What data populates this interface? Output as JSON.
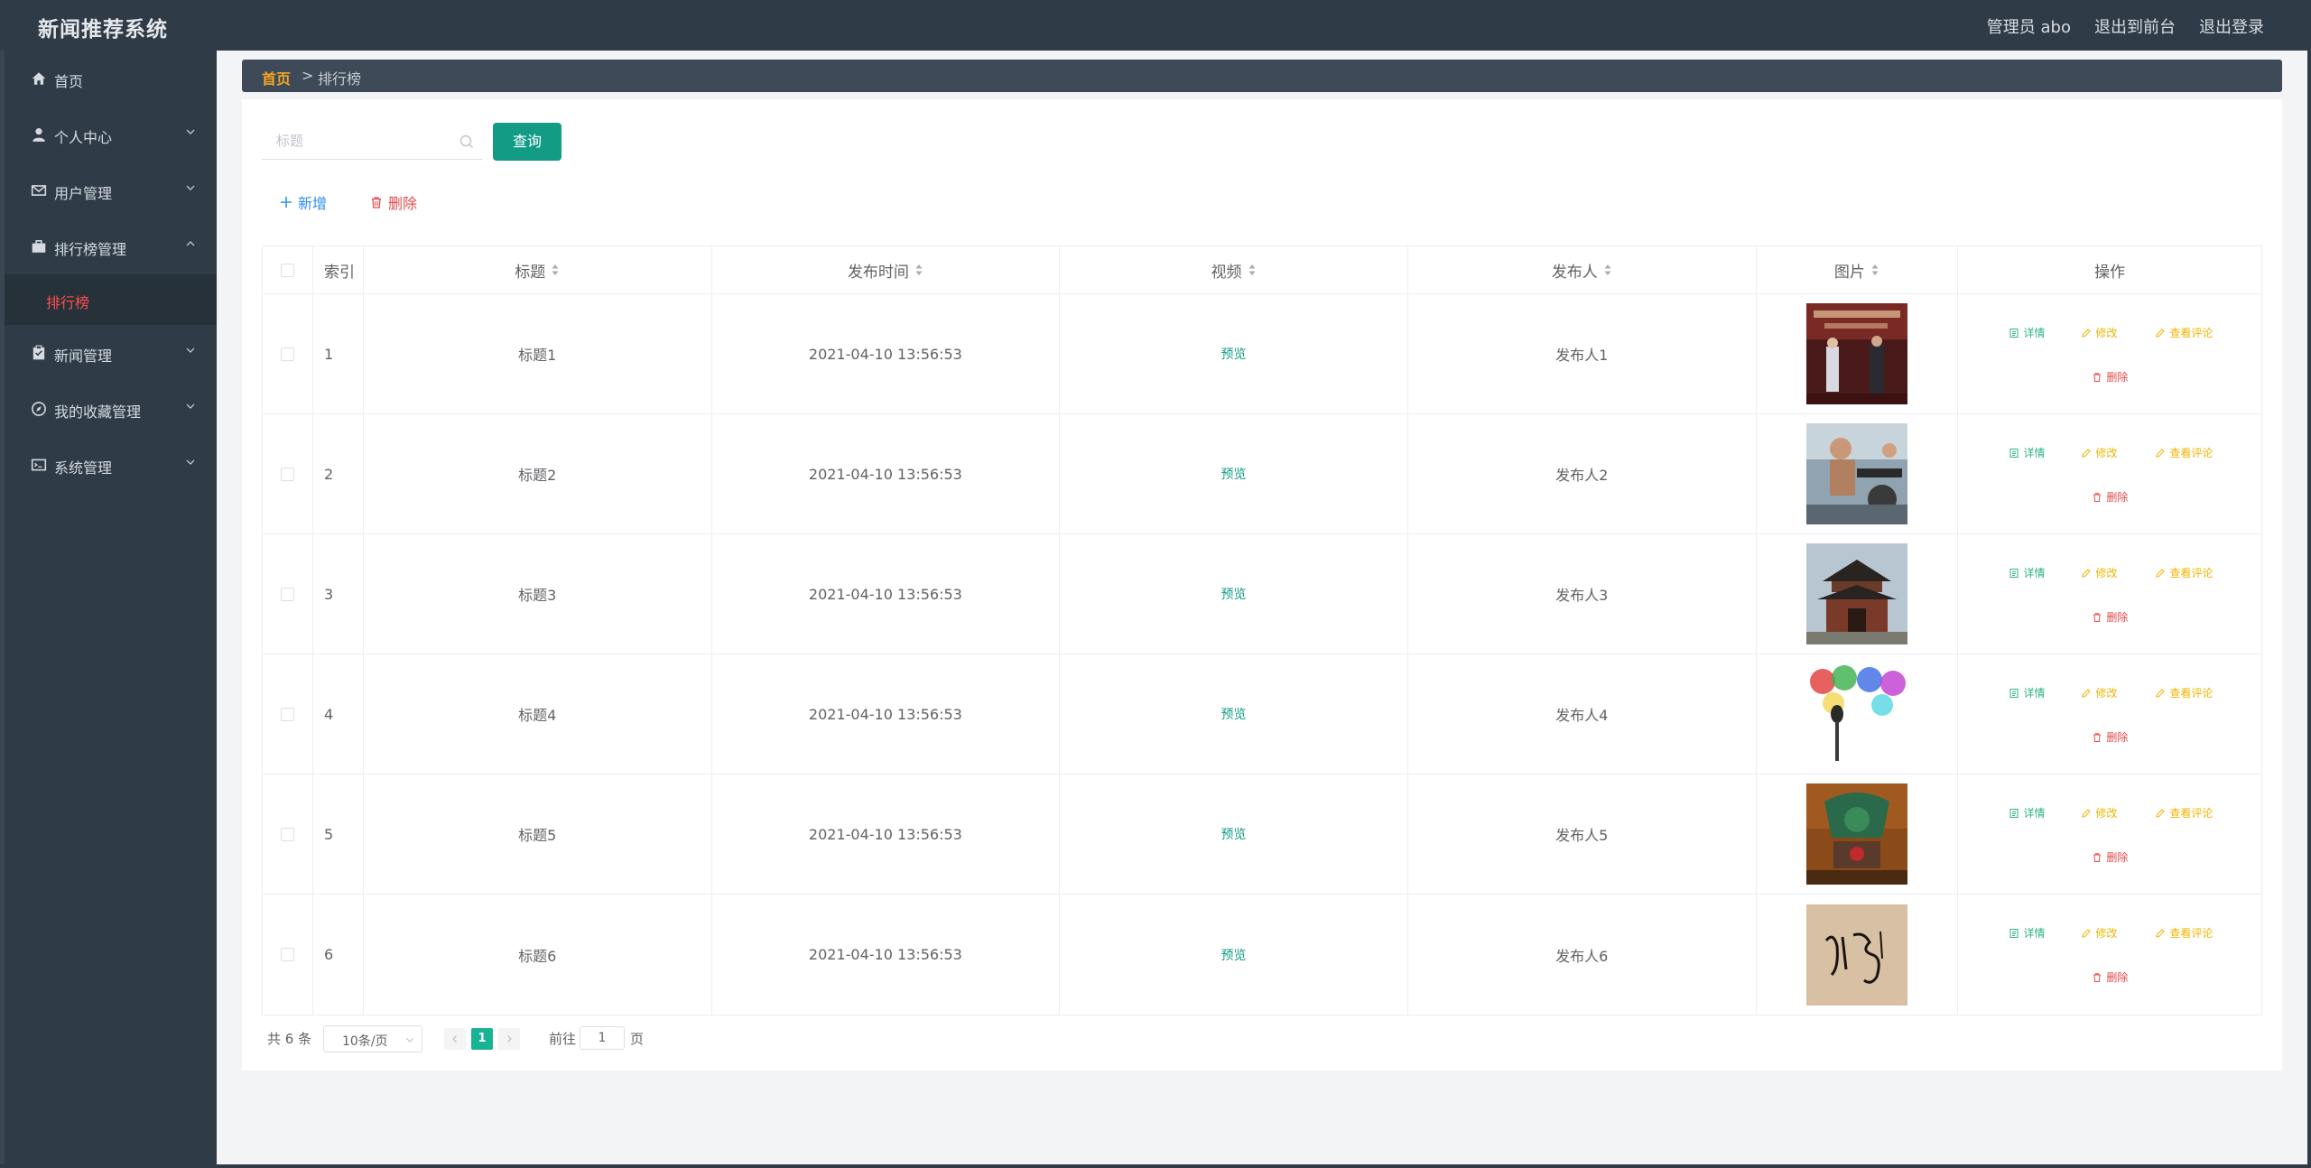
{
  "app": {
    "title": "新闻推荐系统"
  },
  "header": {
    "user": "管理员 abo",
    "to_front": "退出到前台",
    "logout": "退出登录"
  },
  "sidebar": {
    "items": [
      {
        "label": "首页",
        "icon": "home-icon"
      },
      {
        "label": "个人中心",
        "icon": "user-icon"
      },
      {
        "label": "用户管理",
        "icon": "mail-icon"
      },
      {
        "label": "排行榜管理",
        "icon": "briefcase-icon"
      },
      {
        "label": "新闻管理",
        "icon": "clipboard-icon"
      },
      {
        "label": "我的收藏管理",
        "icon": "compass-icon"
      },
      {
        "label": "系统管理",
        "icon": "system-icon"
      }
    ],
    "sub_active": "排行榜"
  },
  "breadcrumb": {
    "home": "首页",
    "sep": ">",
    "current": "排行榜"
  },
  "search": {
    "placeholder": "标题",
    "button": "查询"
  },
  "actions": {
    "add": "新增",
    "delete": "删除"
  },
  "table": {
    "headers": {
      "index": "索引",
      "title": "标题",
      "time": "发布时间",
      "video": "视频",
      "publisher": "发布人",
      "image": "图片",
      "ops": "操作"
    },
    "rows": [
      {
        "index": "1",
        "title": "标题1",
        "time": "2021-04-10 13:56:53",
        "video": "预览",
        "publisher": "发布人1"
      },
      {
        "index": "2",
        "title": "标题2",
        "time": "2021-04-10 13:56:53",
        "video": "预览",
        "publisher": "发布人2"
      },
      {
        "index": "3",
        "title": "标题3",
        "time": "2021-04-10 13:56:53",
        "video": "预览",
        "publisher": "发布人3"
      },
      {
        "index": "4",
        "title": "标题4",
        "time": "2021-04-10 13:56:53",
        "video": "预览",
        "publisher": "发布人4"
      },
      {
        "index": "5",
        "title": "标题5",
        "time": "2021-04-10 13:56:53",
        "video": "预览",
        "publisher": "发布人5"
      },
      {
        "index": "6",
        "title": "标题6",
        "time": "2021-04-10 13:56:53",
        "video": "预览",
        "publisher": "发布人6"
      }
    ],
    "op_labels": {
      "detail": "详情",
      "edit": "修改",
      "comment": "查看评论",
      "delete": "删除"
    }
  },
  "pagination": {
    "total": "共 6 条",
    "page_size": "10条/页",
    "current": "1",
    "goto": "前往",
    "goto_value": "1",
    "page_suffix": "页"
  },
  "colors": {
    "sidebar_bg": "#2f3b47",
    "primary": "#129b85",
    "danger": "#e34a4a",
    "warning": "#f0b400",
    "active_menu": "#ff4d4f"
  }
}
